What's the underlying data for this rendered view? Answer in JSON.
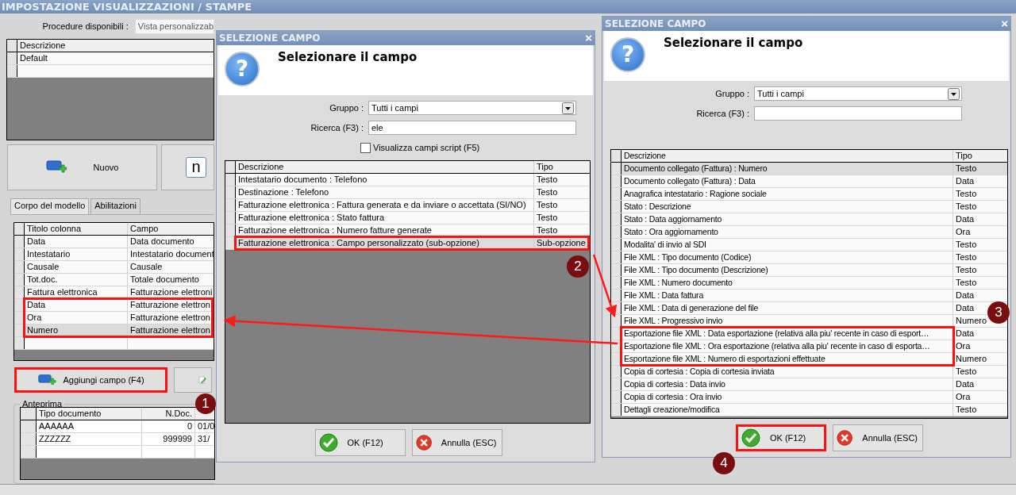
{
  "main": {
    "title": "IMPOSTAZIONE VISUALIZZAZIONI / STAMPE",
    "procedure_label": "Procedure disponibili :",
    "procedure_value": "Vista personalizzab",
    "views_table": {
      "columns": [
        "Descrizione"
      ],
      "rows": [
        {
          "cells": [
            "Default"
          ],
          "selected": false,
          "highlighted": false
        }
      ]
    },
    "new_button": "Nuovo",
    "n_button": "n",
    "tabs": [
      {
        "label": "Corpo del modello",
        "selected": true
      },
      {
        "label": "Abilitazioni",
        "selected": false
      }
    ],
    "fields_table": {
      "columns": [
        "Titolo colonna",
        "Campo"
      ],
      "rows": [
        {
          "cells": [
            "Data",
            "Data documento"
          ],
          "selected": false,
          "highlighted": false
        },
        {
          "cells": [
            "Intestatario",
            "Intestatario document"
          ],
          "selected": false,
          "highlighted": false
        },
        {
          "cells": [
            "Causale",
            "Causale"
          ],
          "selected": false,
          "highlighted": false
        },
        {
          "cells": [
            "Tot.doc.",
            "Totale documento"
          ],
          "selected": false,
          "highlighted": false
        },
        {
          "cells": [
            "Fattura elettronica",
            "Fatturazione elettroni"
          ],
          "selected": false,
          "highlighted": false
        },
        {
          "cells": [
            "Data",
            "Fatturazione elettron"
          ],
          "selected": false,
          "highlighted": true
        },
        {
          "cells": [
            "Ora",
            "Fatturazione elettron"
          ],
          "selected": false,
          "highlighted": true
        },
        {
          "cells": [
            "Numero",
            "Fatturazione elettron"
          ],
          "selected": true,
          "highlighted": true
        }
      ]
    },
    "add_button": {
      "label": "Aggiungi campo (F4)",
      "highlighted": true
    },
    "preview": {
      "title": "Anteprima",
      "columns": [
        "Tipo documento",
        "N.Doc."
      ],
      "rows": [
        [
          "AAAAAA",
          "0",
          "01/0"
        ],
        [
          "ZZZZZZ",
          "999999",
          "31/"
        ]
      ]
    }
  },
  "dialogs": [
    {
      "title": "SELEZIONE CAMPO",
      "close": "×",
      "help_icon": "?",
      "heading": "Selezionare il campo",
      "group_label": "Gruppo :",
      "group_value": "Tutti i campi",
      "search_label": "Ricerca (F3) :",
      "search_value": "ele",
      "script_checkbox": {
        "label": "Visualizza campi script (F5)",
        "checked": false
      },
      "columns": [
        "Descrizione",
        "Tipo"
      ],
      "rows": [
        {
          "description": "Intestatario documento : Telefono",
          "type": "Testo",
          "selected": false,
          "highlighted": false
        },
        {
          "description": "Destinazione : Telefono",
          "type": "Testo",
          "selected": false,
          "highlighted": false
        },
        {
          "description": "Fatturazione elettronica : Fattura generata e da inviare o accettata (SI/NO)",
          "type": "Testo",
          "selected": false,
          "highlighted": false
        },
        {
          "description": "Fatturazione elettronica : Stato fattura",
          "type": "Testo",
          "selected": false,
          "highlighted": false
        },
        {
          "description": "Fatturazione elettronica : Numero fatture generate",
          "type": "Testo",
          "selected": false,
          "highlighted": false
        },
        {
          "description": "Fatturazione elettronica : Campo personalizzato (sub-opzione)",
          "type": "Sub-opzione",
          "selected": true,
          "highlighted": true
        }
      ],
      "buttons": [
        {
          "kind": "ok",
          "label": "OK (F12)",
          "highlighted": false
        },
        {
          "kind": "cancel",
          "label": "Annulla (ESC)",
          "highlighted": false
        }
      ]
    },
    {
      "title": "SELEZIONE CAMPO",
      "close": "×",
      "help_icon": "?",
      "heading": "Selezionare il campo",
      "group_label": "Gruppo :",
      "group_value": "Tutti i campi",
      "search_label": "Ricerca (F3) :",
      "columns": [
        "Descrizione",
        "Tipo"
      ],
      "rows": [
        {
          "description": "Documento collegato (Fattura) : Numero",
          "type": "Testo",
          "selected": true,
          "highlighted": false
        },
        {
          "description": "Documento collegato (Fattura) : Data",
          "type": "Data",
          "selected": false,
          "highlighted": false
        },
        {
          "description": "Anagrafica intestatario : Ragione sociale",
          "type": "Testo",
          "selected": false,
          "highlighted": false
        },
        {
          "description": "Stato : Descrizione",
          "type": "Testo",
          "selected": false,
          "highlighted": false
        },
        {
          "description": "Stato : Data aggiornamento",
          "type": "Data",
          "selected": false,
          "highlighted": false
        },
        {
          "description": "Stato : Ora aggiornamento",
          "type": "Ora",
          "selected": false,
          "highlighted": false
        },
        {
          "description": "Modalita' di invio al SDI",
          "type": "Testo",
          "selected": false,
          "highlighted": false
        },
        {
          "description": "File XML : Tipo documento (Codice)",
          "type": "Testo",
          "selected": false,
          "highlighted": false
        },
        {
          "description": "File XML : Tipo documento (Descrizione)",
          "type": "Testo",
          "selected": false,
          "highlighted": false
        },
        {
          "description": "File XML : Numero documento",
          "type": "Testo",
          "selected": false,
          "highlighted": false
        },
        {
          "description": "File XML : Data fattura",
          "type": "Data",
          "selected": false,
          "highlighted": false
        },
        {
          "description": "File XML : Data di generazione del file",
          "type": "Data",
          "selected": false,
          "highlighted": false
        },
        {
          "description": "File XML : Progressivo invio",
          "type": "Numero",
          "selected": false,
          "highlighted": false
        },
        {
          "description": "Esportazione file XML : Data esportazione (relativa alla piu' recente in caso di esport…",
          "type": "Data",
          "selected": false,
          "highlighted": true
        },
        {
          "description": "Esportazione file XML : Ora esportazione (relativa alla piu' recente in caso di esporta…",
          "type": "Ora",
          "selected": false,
          "highlighted": true
        },
        {
          "description": "Esportazione file XML : Numero di esportazioni effettuate",
          "type": "Numero",
          "selected": false,
          "highlighted": true
        },
        {
          "description": "Copia di cortesia : Copia di cortesia inviata",
          "type": "Testo",
          "selected": false,
          "highlighted": false
        },
        {
          "description": "Copia di cortesia : Data invio",
          "type": "Data",
          "selected": false,
          "highlighted": false
        },
        {
          "description": "Copia di cortesia : Ora invio",
          "type": "Ora",
          "selected": false,
          "highlighted": false
        },
        {
          "description": "Dettagli creazione/modifica",
          "type": "Testo",
          "selected": false,
          "highlighted": false
        }
      ],
      "buttons": [
        {
          "kind": "ok",
          "label": "OK (F12)",
          "highlighted": true
        },
        {
          "kind": "cancel",
          "label": "Annulla (ESC)",
          "highlighted": false
        }
      ]
    }
  ],
  "callouts": [
    {
      "number": "1"
    },
    {
      "number": "2"
    },
    {
      "number": "3"
    },
    {
      "number": "4"
    }
  ]
}
